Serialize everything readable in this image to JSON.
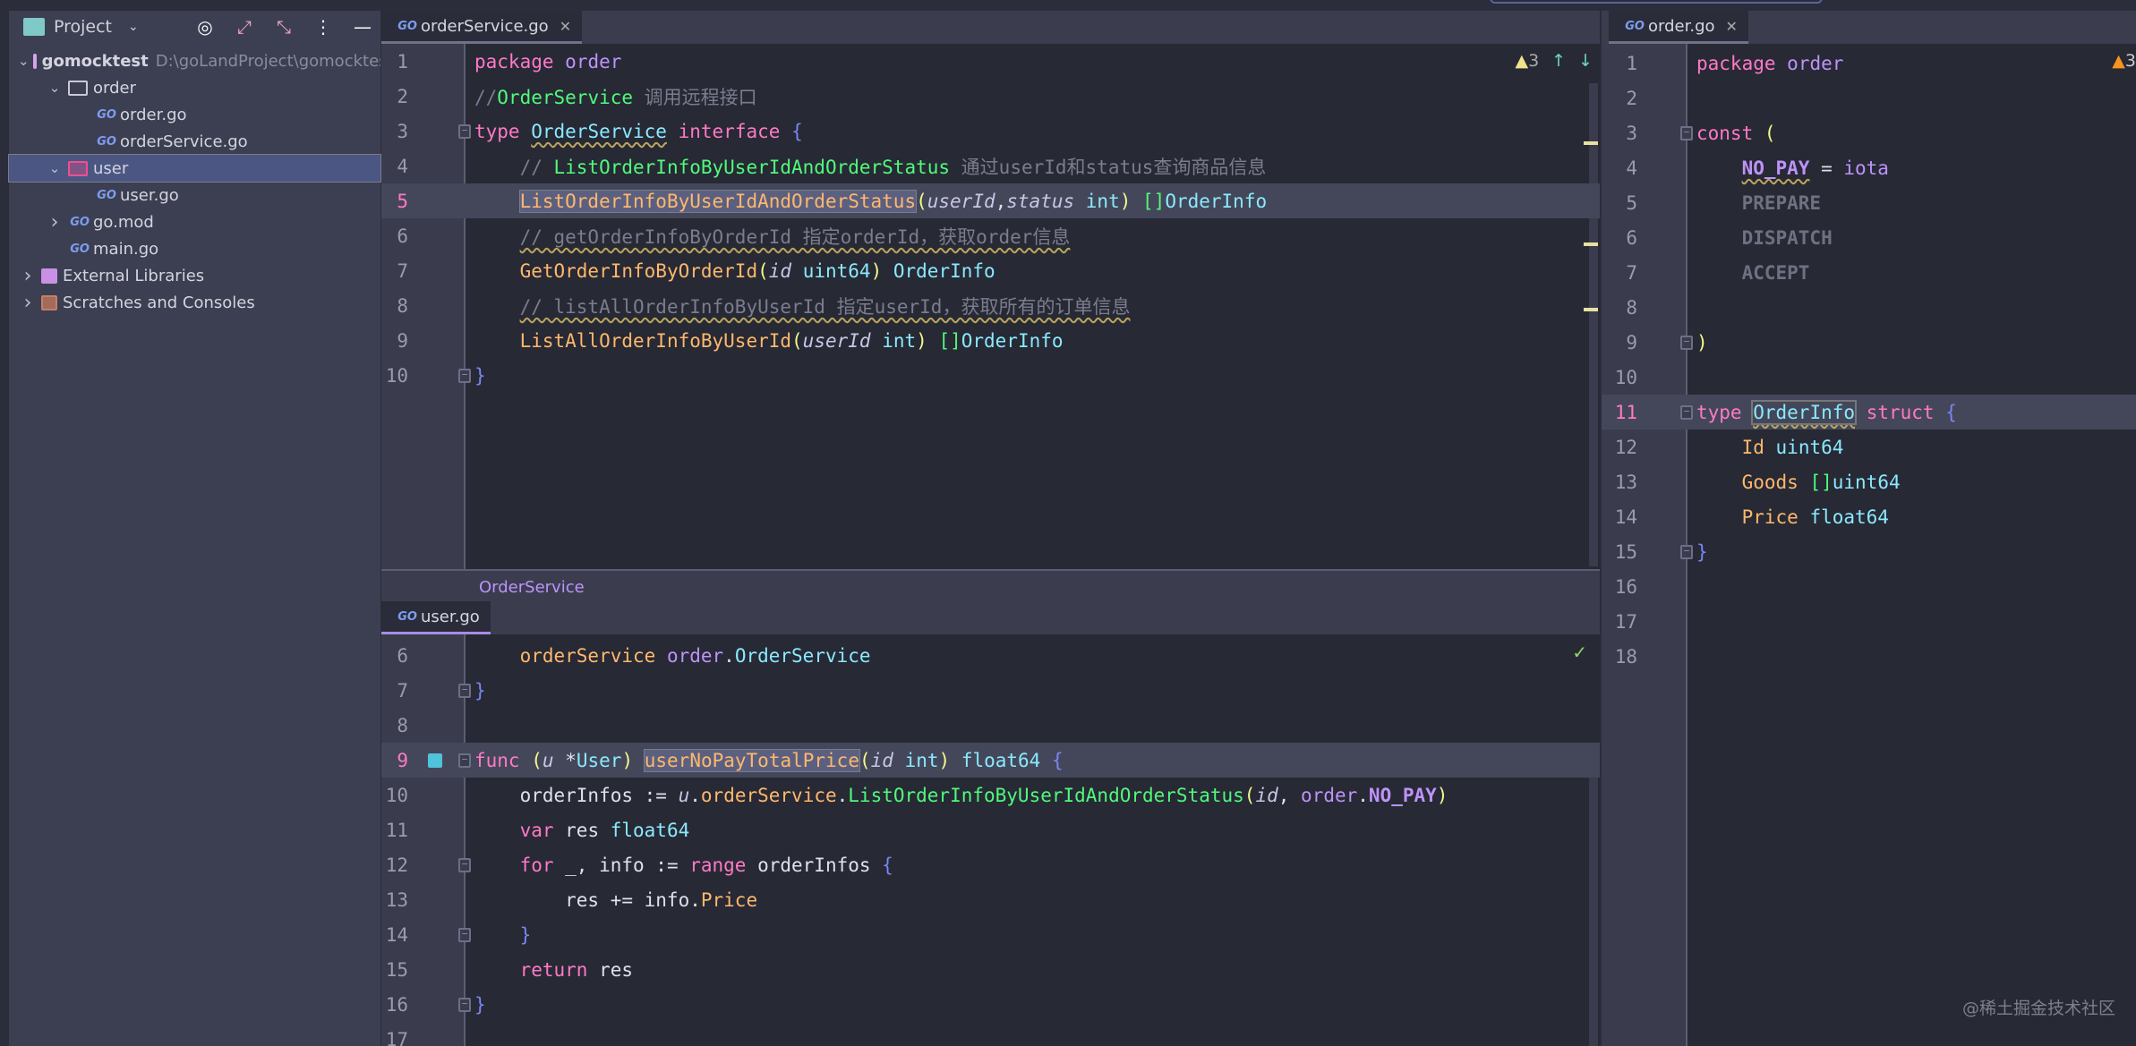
{
  "sidebar": {
    "title": "Project",
    "tools": [
      "target-icon",
      "expand-icon",
      "collapse-icon",
      "more-icon",
      "hide-icon"
    ],
    "tree": [
      {
        "label": "gomocktest",
        "secondary": "D:\\goLandProject\\gomocktest",
        "level": 0,
        "chevron": "down",
        "icon": "module-folder",
        "bold": true
      },
      {
        "label": "order",
        "level": 1,
        "chevron": "down",
        "icon": "folder"
      },
      {
        "label": "order.go",
        "level": 2,
        "icon": "go-file"
      },
      {
        "label": "orderService.go",
        "level": 2,
        "icon": "go-file"
      },
      {
        "label": "user",
        "level": 1,
        "chevron": "down",
        "icon": "user-folder",
        "selected": true
      },
      {
        "label": "user.go",
        "level": 2,
        "icon": "go-file"
      },
      {
        "label": "go.mod",
        "level": 1,
        "chevron": "right",
        "icon": "go-file"
      },
      {
        "label": "main.go",
        "level": 1,
        "icon": "go-file"
      },
      {
        "label": "External Libraries",
        "level": 0,
        "chevron": "right",
        "icon": "library"
      },
      {
        "label": "Scratches and Consoles",
        "level": 0,
        "chevron": "right",
        "icon": "scratches"
      }
    ]
  },
  "editors": {
    "top": {
      "tab": "orderService.go",
      "tab_icon": "GO",
      "warnings": "3",
      "current_line": 5,
      "folds": [
        3,
        10
      ],
      "lines": [
        {
          "n": 1,
          "t": [
            [
              "package",
              "k"
            ],
            [
              " "
            ],
            [
              "order",
              "p"
            ]
          ]
        },
        {
          "n": 2,
          "t": [
            [
              "//",
              "cm"
            ],
            [
              "OrderService",
              "g"
            ],
            [
              " 调用远程接口",
              "cm"
            ]
          ]
        },
        {
          "n": 3,
          "t": [
            [
              "type",
              "k"
            ],
            [
              " "
            ],
            [
              "OrderService",
              "c wv"
            ],
            [
              " "
            ],
            [
              "interface",
              "k"
            ],
            [
              " "
            ],
            [
              "{",
              "b"
            ]
          ]
        },
        {
          "n": 4,
          "t": [
            [
              "    "
            ],
            [
              "// ",
              "cm"
            ],
            [
              "ListOrderInfoByUserIdAndOrderStatus",
              "g"
            ],
            [
              " 通过userId和status查询商品信息",
              "cm"
            ]
          ]
        },
        {
          "n": 5,
          "t": [
            [
              "    "
            ],
            [
              "ListOrderInfoByUserIdAndOrderStatus",
              "o sel"
            ],
            [
              "(",
              "y"
            ],
            [
              "userId",
              "i"
            ],
            [
              ",",
              "w"
            ],
            [
              "status",
              "i"
            ],
            [
              " "
            ],
            [
              "int",
              "c"
            ],
            [
              ")",
              "y"
            ],
            [
              " "
            ],
            [
              "[]",
              "gr"
            ],
            [
              "OrderInfo",
              "c"
            ]
          ]
        },
        {
          "n": 6,
          "t": [
            [
              "    "
            ],
            [
              "// getOrderInfoByOrderId 指定orderId，获取order信息",
              "cm wv"
            ]
          ]
        },
        {
          "n": 7,
          "t": [
            [
              "    "
            ],
            [
              "GetOrderInfoByOrderId",
              "o"
            ],
            [
              "(",
              "y"
            ],
            [
              "id",
              "i"
            ],
            [
              " "
            ],
            [
              "uint64",
              "c"
            ],
            [
              ")",
              "y"
            ],
            [
              " "
            ],
            [
              "OrderInfo",
              "c"
            ]
          ]
        },
        {
          "n": 8,
          "t": [
            [
              "    "
            ],
            [
              "// listAllOrderInfoByUserId 指定userId，获取所有的订单信息",
              "cm wv"
            ]
          ]
        },
        {
          "n": 9,
          "t": [
            [
              "    "
            ],
            [
              "ListAllOrderInfoByUserId",
              "o"
            ],
            [
              "(",
              "y"
            ],
            [
              "userId",
              "i"
            ],
            [
              " "
            ],
            [
              "int",
              "c"
            ],
            [
              ")",
              "y"
            ],
            [
              " "
            ],
            [
              "[]",
              "gr"
            ],
            [
              "OrderInfo",
              "c"
            ]
          ]
        },
        {
          "n": 10,
          "t": [
            [
              "}",
              "b"
            ]
          ]
        }
      ]
    },
    "breadcrumb": "OrderService",
    "bottom": {
      "tab": "user.go",
      "tab_icon": "GO",
      "status": "✓",
      "current_line": 9,
      "folds": [
        7,
        9,
        12,
        14,
        16
      ],
      "lines": [
        {
          "n": 6,
          "t": [
            [
              "    "
            ],
            [
              "orderService",
              "o"
            ],
            [
              " "
            ],
            [
              "order",
              "p"
            ],
            [
              ".",
              "w"
            ],
            [
              "OrderService",
              "c"
            ]
          ]
        },
        {
          "n": 7,
          "t": [
            [
              "}",
              "b"
            ]
          ]
        },
        {
          "n": 8,
          "t": []
        },
        {
          "n": 9,
          "t": [
            [
              "func",
              "k"
            ],
            [
              " "
            ],
            [
              "(",
              "y"
            ],
            [
              "u",
              "i"
            ],
            [
              " "
            ],
            [
              "*",
              "w"
            ],
            [
              "User",
              "c"
            ],
            [
              ")",
              "y"
            ],
            [
              " "
            ],
            [
              "userNoPayTotalPrice",
              "o sel"
            ],
            [
              "(",
              "y"
            ],
            [
              "id",
              "i"
            ],
            [
              " "
            ],
            [
              "int",
              "c"
            ],
            [
              ")",
              "y"
            ],
            [
              " "
            ],
            [
              "float64",
              "c"
            ],
            [
              " "
            ],
            [
              "{",
              "b"
            ]
          ]
        },
        {
          "n": 10,
          "t": [
            [
              "    "
            ],
            [
              "orderInfos := ",
              "w"
            ],
            [
              "u",
              "i"
            ],
            [
              ".",
              "w"
            ],
            [
              "orderService",
              "o"
            ],
            [
              ".",
              "w"
            ],
            [
              "ListOrderInfoByUserIdAndOrderStatus",
              "g"
            ],
            [
              "(",
              "y"
            ],
            [
              "id",
              "i"
            ],
            [
              ", ",
              "w"
            ],
            [
              "order",
              "p"
            ],
            [
              ".",
              "w"
            ],
            [
              "NO_PAY",
              "cst"
            ],
            [
              ")",
              "y"
            ]
          ]
        },
        {
          "n": 11,
          "t": [
            [
              "    "
            ],
            [
              "var",
              "k"
            ],
            [
              " res ",
              "w"
            ],
            [
              "float64",
              "c"
            ]
          ]
        },
        {
          "n": 12,
          "t": [
            [
              "    "
            ],
            [
              "for",
              "k"
            ],
            [
              " _, info := ",
              "w"
            ],
            [
              "range",
              "k"
            ],
            [
              " orderInfos ",
              "w"
            ],
            [
              "{",
              "b"
            ]
          ]
        },
        {
          "n": 13,
          "t": [
            [
              "        res += info.",
              "w"
            ],
            [
              "Price",
              "o"
            ]
          ]
        },
        {
          "n": 14,
          "t": [
            [
              "    "
            ],
            [
              "}",
              "b"
            ]
          ]
        },
        {
          "n": 15,
          "t": [
            [
              "    "
            ],
            [
              "return",
              "k"
            ],
            [
              " res",
              "w"
            ]
          ]
        },
        {
          "n": 16,
          "t": [
            [
              "}",
              "b"
            ]
          ]
        },
        {
          "n": 17,
          "t": []
        }
      ]
    },
    "right": {
      "tab": "order.go",
      "tab_icon": "GO",
      "warnings": "3",
      "current_line": 11,
      "folds": [
        3,
        9,
        11,
        15
      ],
      "lines": [
        {
          "n": 1,
          "t": [
            [
              "package",
              "k"
            ],
            [
              " "
            ],
            [
              "order",
              "p"
            ]
          ]
        },
        {
          "n": 2,
          "t": []
        },
        {
          "n": 3,
          "t": [
            [
              "const",
              "k"
            ],
            [
              " "
            ],
            [
              "(",
              "y"
            ]
          ]
        },
        {
          "n": 4,
          "t": [
            [
              "    "
            ],
            [
              "NO_PAY",
              "cst wv"
            ],
            [
              " = ",
              "w"
            ],
            [
              "iota",
              "p"
            ]
          ]
        },
        {
          "n": 5,
          "t": [
            [
              "    "
            ],
            [
              "PREPARE",
              "dim"
            ]
          ]
        },
        {
          "n": 6,
          "t": [
            [
              "    "
            ],
            [
              "DISPATCH",
              "dim"
            ]
          ]
        },
        {
          "n": 7,
          "t": [
            [
              "    "
            ],
            [
              "ACCEPT",
              "dim"
            ]
          ]
        },
        {
          "n": 8,
          "t": []
        },
        {
          "n": 9,
          "t": [
            [
              ")",
              "y"
            ]
          ]
        },
        {
          "n": 10,
          "t": []
        },
        {
          "n": 11,
          "t": [
            [
              "type",
              "k"
            ],
            [
              " "
            ],
            [
              "OrderInfo",
              "c wv box"
            ],
            [
              " "
            ],
            [
              "struct",
              "k"
            ],
            [
              " "
            ],
            [
              "{",
              "b"
            ]
          ]
        },
        {
          "n": 12,
          "t": [
            [
              "    "
            ],
            [
              "Id",
              "o"
            ],
            [
              " "
            ],
            [
              "uint64",
              "c"
            ]
          ]
        },
        {
          "n": 13,
          "t": [
            [
              "    "
            ],
            [
              "Goods",
              "o"
            ],
            [
              " "
            ],
            [
              "[]",
              "gr"
            ],
            [
              "uint64",
              "c"
            ]
          ]
        },
        {
          "n": 14,
          "t": [
            [
              "    "
            ],
            [
              "Price",
              "o"
            ],
            [
              " "
            ],
            [
              "float64",
              "c"
            ]
          ]
        },
        {
          "n": 15,
          "t": [
            [
              "}",
              "b"
            ]
          ]
        },
        {
          "n": 16,
          "t": []
        },
        {
          "n": 17,
          "t": []
        },
        {
          "n": 18,
          "t": []
        }
      ]
    }
  },
  "watermark": "@稀土掘金技术社区",
  "colors": {
    "keyword": "#ff79c6",
    "function": "#ffb86c",
    "type": "#8be9fd",
    "comment_id": "#50fa7b",
    "package": "#bd93f9",
    "selection": "#4b5683"
  }
}
